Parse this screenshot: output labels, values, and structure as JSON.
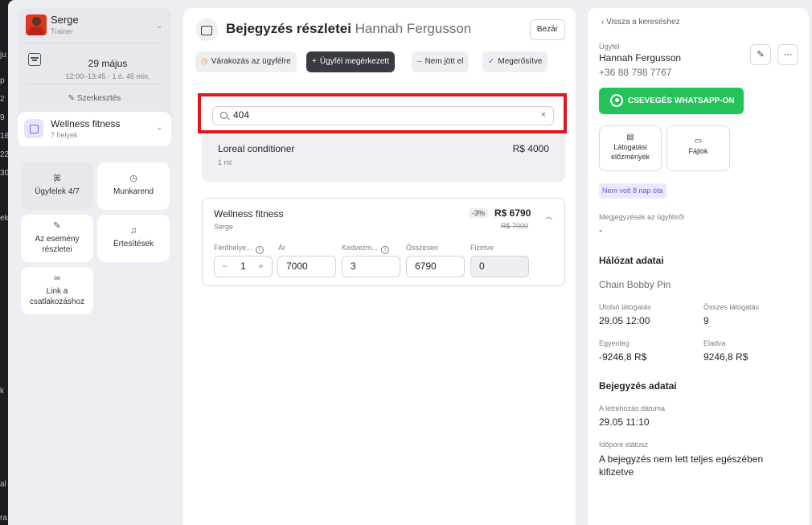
{
  "background": {
    "left_edge_texts": [
      "ju",
      "p",
      "2",
      "9",
      "16",
      "22",
      "30",
      "ek",
      "k",
      "al",
      "ra"
    ]
  },
  "sidebar": {
    "trainer": {
      "name": "Serge",
      "role": "Trainer"
    },
    "date": {
      "main": "29 május",
      "sub": "12:00–13:45 · 1 ó. 45 min."
    },
    "edit_label": "Szerkesztés",
    "service": {
      "name": "Wellness fitness",
      "sub": "7 helyek"
    },
    "tiles": [
      {
        "label": "Ügyfelek 4/7",
        "icon": "users-icon"
      },
      {
        "label": "Munkarend",
        "icon": "clock-icon"
      },
      {
        "label": "Az esemény részletei",
        "icon": "edit-document-icon"
      },
      {
        "label": "Értesítések",
        "icon": "bell-icon"
      },
      {
        "label": "Link a csatlakozáshoz",
        "icon": "link-icon"
      }
    ]
  },
  "center": {
    "title": "Bejegyzés részletei",
    "client_name": "Hannah Fergusson",
    "close_label": "Bezár",
    "statuses": [
      {
        "label": "Várakozás az ügyfélre",
        "icon": "clock-icon",
        "sym": "◷"
      },
      {
        "label": "Ügyfél megérkezett",
        "icon": "plus-icon",
        "sym": "+"
      },
      {
        "label": "Nem jött el",
        "icon": "minus-icon",
        "sym": "–"
      },
      {
        "label": "Megerősítve",
        "icon": "check-icon",
        "sym": "✓"
      }
    ],
    "search": {
      "value": "404",
      "clear": "×"
    },
    "result": {
      "name": "Loreal conditioner",
      "sub": "1 ml",
      "price": "R$ 4000"
    },
    "line_item": {
      "name": "Wellness fitness",
      "sub": "Serge",
      "discount_badge": "-3%",
      "price": "R$ 6790",
      "old_price": "R$ 7000",
      "labels": {
        "places": "Férőhelye...",
        "price": "Ár",
        "discount": "Kedvezm...",
        "total": "Összesen",
        "paid": "Fizetve"
      },
      "info_glyph": "i",
      "quantity": "1",
      "minus": "−",
      "plus": "+",
      "price_value": "7000",
      "discount_value": "3",
      "total_value": "6790",
      "paid_value": "0"
    }
  },
  "right": {
    "back_label": "Vissza a kereséshez",
    "client_label": "Ügyfél",
    "client_name": "Hannah Fergusson",
    "client_phone": "+36 88 798 7767",
    "whatsapp_label": "CSEVEGÉS WHATSAPP-ON",
    "history_label": "Látogatási előzmények",
    "files_label": "Fájlok",
    "notes_badge": "Nem volt 8 nap óta",
    "notes_label": "Megjegyzések az ügyfélről",
    "notes_value": "-",
    "network_title": "Hálózat adatai",
    "network_name": "Chain Bobby Pin",
    "last_visit_label": "Utolsó látogatás",
    "last_visit_value": "29.05 12:00",
    "total_visits_label": "Összes látogatás",
    "total_visits_value": "9",
    "balance_label": "Egyenleg",
    "balance_value": "-9246,8 R$",
    "sold_label": "Eladva",
    "sold_value": "9246,8 R$",
    "entry_title": "Bejegyzés adatai",
    "created_label": "A létrehozás dátuma",
    "created_value": "29.05 11:10",
    "status_label": "Időpont státusz",
    "status_value": "A bejegyzés nem lett teljes egészében kifizetve"
  },
  "colors": {
    "accent_dark": "#393b42",
    "whatsapp": "#25c25a",
    "highlight": "#e4141a",
    "badge_purple": "#6e55d8"
  }
}
